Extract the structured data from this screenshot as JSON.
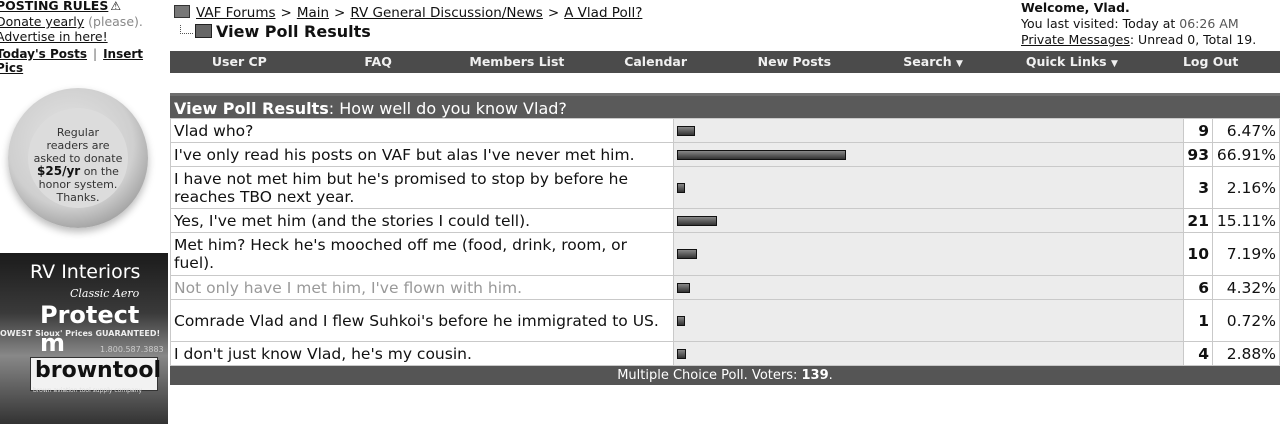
{
  "sidebar": {
    "posting_rules": "POSTING RULES",
    "donate_link": "Donate yearly",
    "donate_please": "(please).",
    "advertise": "Advertise in here!",
    "todays_posts": "Today's Posts",
    "insert_pics": "Insert Pics",
    "badge_line1": "Regular",
    "badge_line2": "readers are",
    "badge_line3": "asked to donate",
    "badge_amount": "$25/yr",
    "badge_line4": "on the",
    "badge_line5": "honor system.",
    "badge_line6": "Thanks.",
    "ad_title": "RV Interiors",
    "ad_script": "Classic Aero",
    "ad_protect": "Protect m",
    "ad_guarantee": "OWEST Sioux' Prices GUARANTEED!",
    "ad_phone": "1.800.587.3883",
    "ad_brand": "browntool",
    "ad_brand_sub": "brown aviation tool supply company"
  },
  "breadcrumb": {
    "forums": "VAF Forums",
    "main": "Main",
    "forum": "RV General Discussion/News",
    "thread": "A Vlad Poll?",
    "page_title": "View Poll Results"
  },
  "welcome": {
    "greeting": "Welcome, Vlad.",
    "visited_prefix": "You last visited: Today at",
    "visited_time": "06:26 AM",
    "pm_label": "Private Messages",
    "pm_status": ": Unread 0, Total 19."
  },
  "nav": {
    "items": [
      "User CP",
      "FAQ",
      "Members List",
      "Calendar",
      "New Posts",
      "Search",
      "Quick Links",
      "Log Out"
    ]
  },
  "poll": {
    "header_bold": "View Poll Results",
    "question": ": How well do you know Vlad?",
    "options": [
      {
        "text": "Vlad who?",
        "votes": "9",
        "percent": "6.47%",
        "fraction": 0.0647
      },
      {
        "text": "I've only read his posts on VAF but alas I've never met him.",
        "votes": "93",
        "percent": "66.91%",
        "fraction": 0.6691
      },
      {
        "text": "I have not met him but he's promised to stop by before he reaches TBO next year.",
        "votes": "3",
        "percent": "2.16%",
        "fraction": 0.0216
      },
      {
        "text": "Yes, I've met him (and the stories I could tell).",
        "votes": "21",
        "percent": "15.11%",
        "fraction": 0.1511
      },
      {
        "text": "Met him? Heck he's mooched off me (food, drink, room, or fuel).",
        "votes": "10",
        "percent": "7.19%",
        "fraction": 0.0719
      },
      {
        "text": "Not only have I met him, I've flown with him.",
        "votes": "6",
        "percent": "4.32%",
        "fraction": 0.0432
      },
      {
        "text": "Comrade Vlad and I flew Suhkoi's before he immigrated to US.",
        "votes": "1",
        "percent": "0.72%",
        "fraction": 0.0072
      },
      {
        "text": "I don't just know Vlad, he's my cousin.",
        "votes": "4",
        "percent": "2.88%",
        "fraction": 0.0288
      }
    ],
    "footer_prefix": "Multiple Choice Poll. Voters:",
    "voters": "139",
    "footer_suffix": "."
  }
}
